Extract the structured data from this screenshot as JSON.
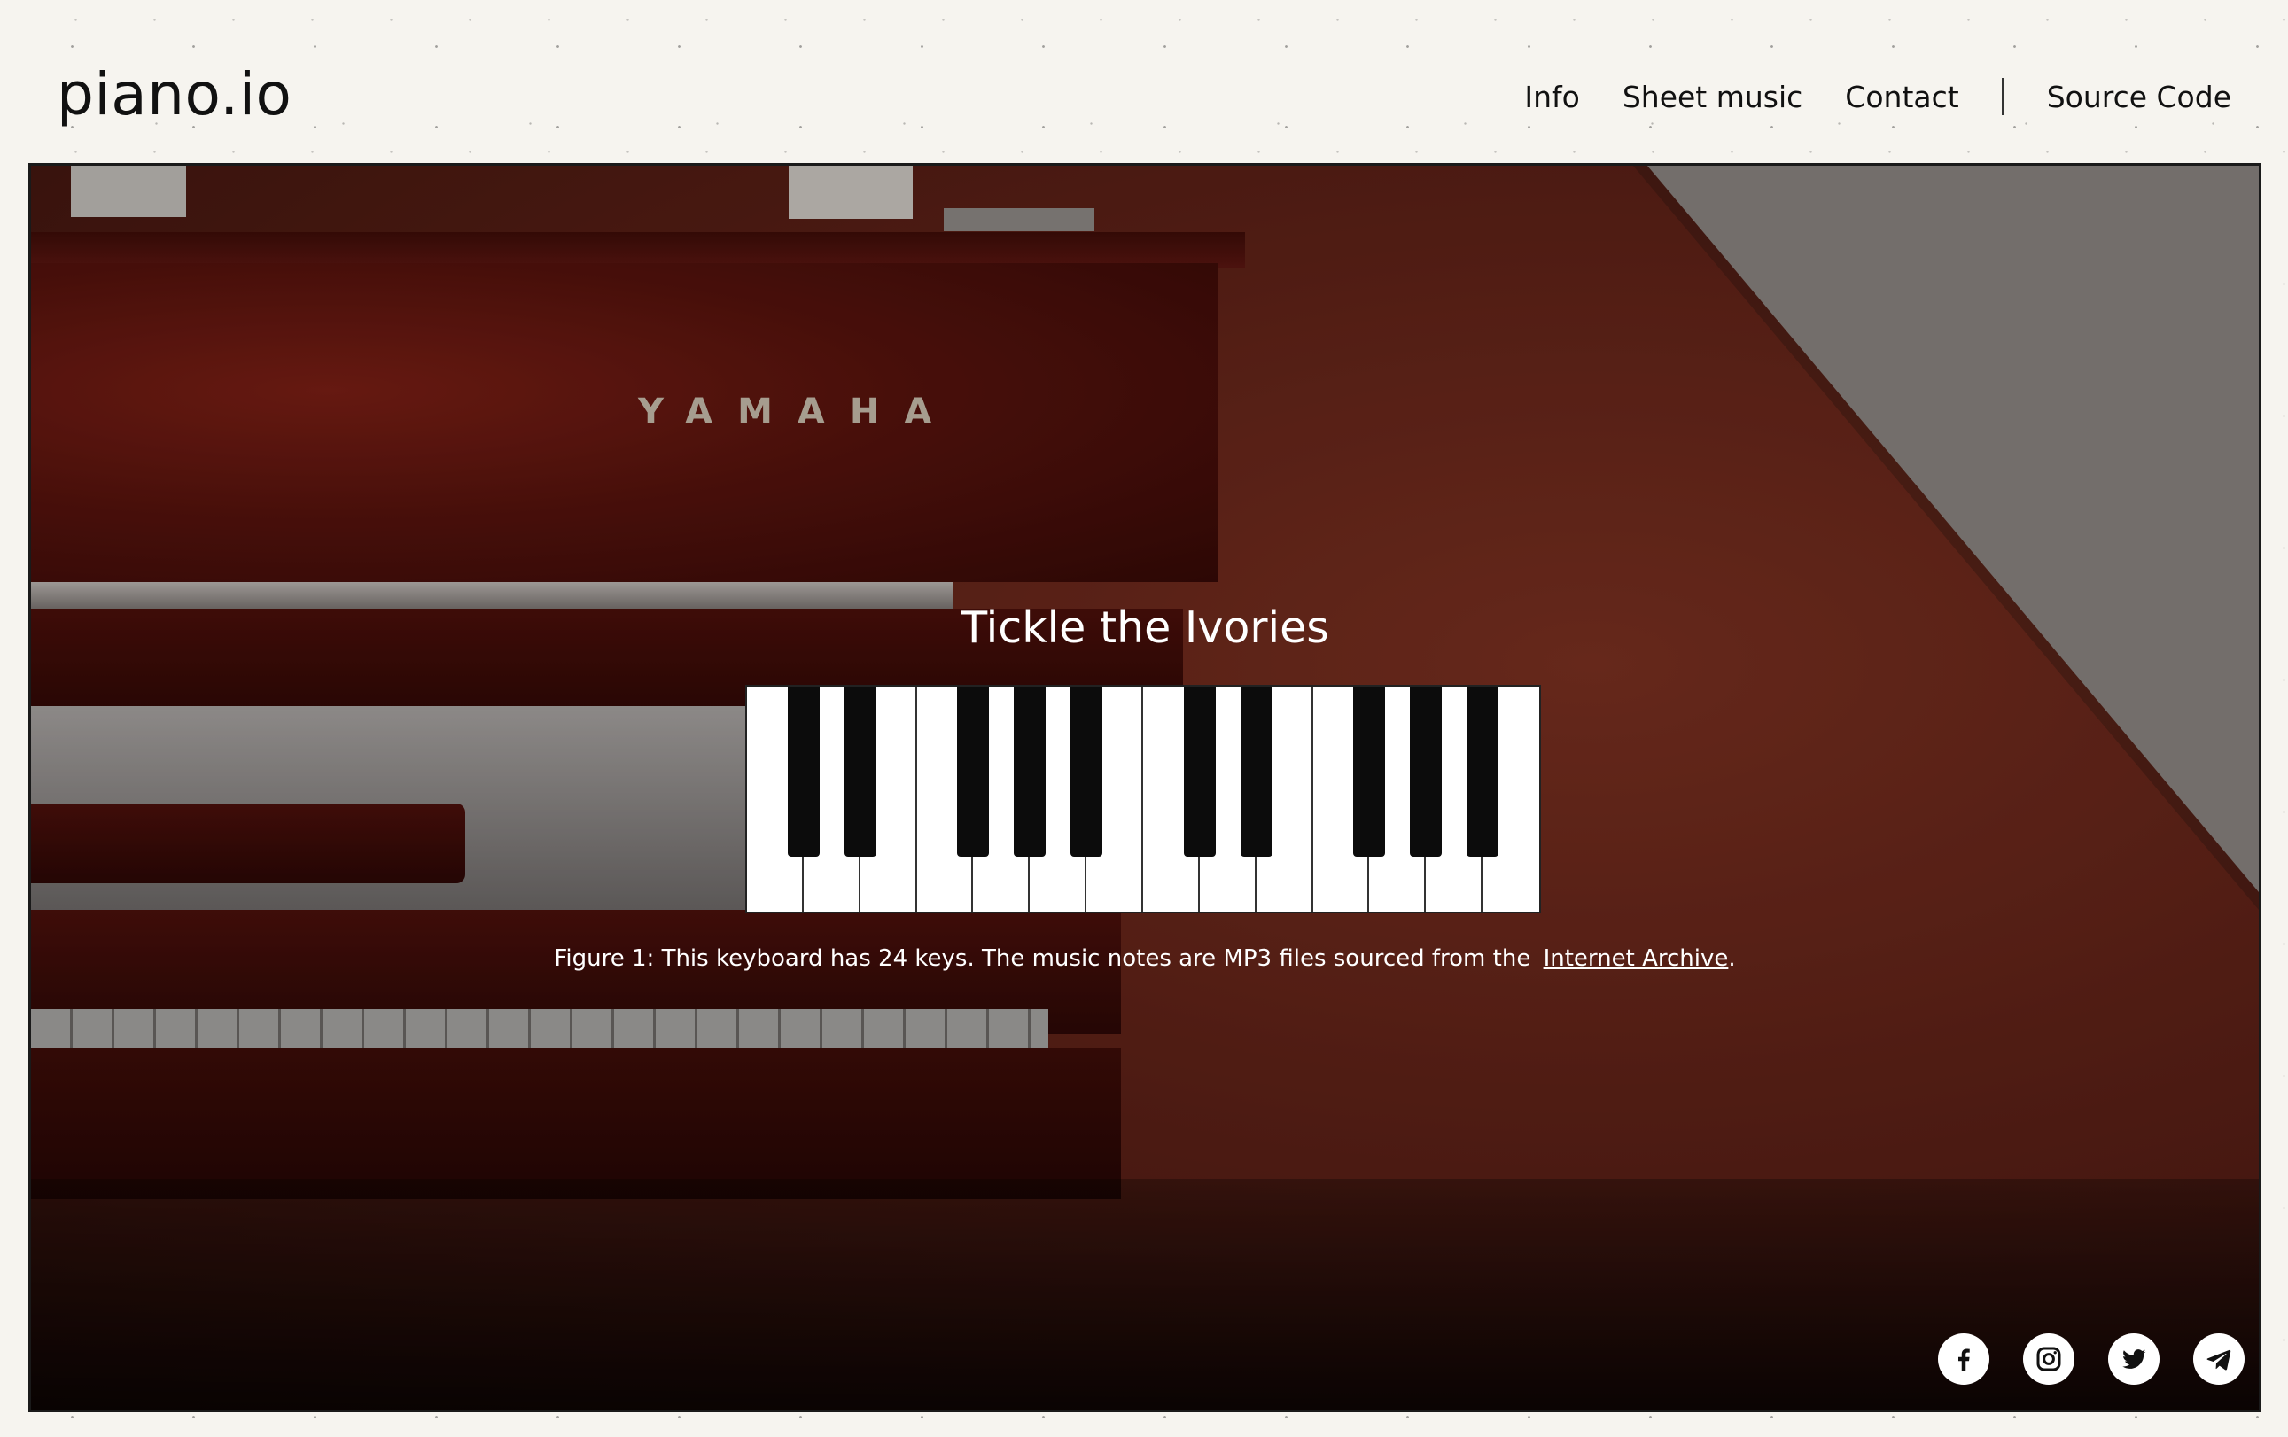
{
  "header": {
    "logo": "piano.io",
    "nav": [
      {
        "label": "Info"
      },
      {
        "label": "Sheet music"
      },
      {
        "label": "Contact"
      }
    ],
    "source_code": "Source Code"
  },
  "hero": {
    "brand_text": "YAMAHA",
    "title": "Tickle the Ivories",
    "caption_prefix": "Figure 1: This keyboard has 24 keys. The music notes are MP3 files sourced from the",
    "caption_link": "Internet Archive",
    "caption_suffix": ".",
    "keyboard": {
      "white_keys": 14,
      "black_key_after": [
        0,
        1,
        3,
        4,
        5,
        7,
        8,
        10,
        11,
        12
      ]
    }
  },
  "social": [
    {
      "icon": "facebook-icon"
    },
    {
      "icon": "instagram-icon"
    },
    {
      "icon": "twitter-icon"
    },
    {
      "icon": "telegram-icon"
    }
  ],
  "colors": {
    "page_bg": "#f6f4ef",
    "hero_bg": "#5a1e14",
    "text": "#111111"
  }
}
